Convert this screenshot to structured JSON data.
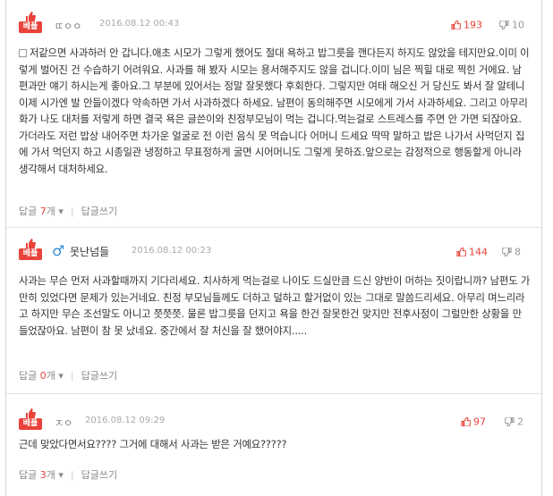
{
  "comments": [
    {
      "badge": "베플",
      "nickname": "ㄸㅇㅇ",
      "date": "2016.08.12 00:43",
      "up": "193",
      "down": "10",
      "text": "저같으면 사과하러 안 갑니다.애초 시모가 그렇게 했어도 절대 욕하고 밥그릇을 깬다든지 하지도 않았을 테지만요.이미 이렇게 벌어진 건 수습하기 어려워요. 사과를 해 봤자 시모는 용서해주지도 않을 겁니다.이미 님은 찍힐 대로 찍힌 거에요. 남편과만 얘기 하시는게 좋아요.그 부분에 있어서는 정말 잘못했다 후회한다. 그렇지만 여태 해오신 거 당신도 봐서 잘 알테니 이제 시가엔 발 안들이겠다 약속하면 가서 사과하겠다 하세요. 남편이 동의해주면 시모에게 가서 사과하세요. 그리고 아무리 화가 나도 대처를 저렇게 하면 결국 욕은 글쓴이와 친정부모님이 먹는 겁니다.먹는걸로 스트레스를 주면 안 가면 되잖아요.가더라도 저런 밥상 내어주면 차가운 얼굴로 전 이런 음식 못 먹습니다 어머니 드세요 딱딱 말하고 밥은 나가서 사먹던지 집에 가서 먹던지 하고 시종일관 냉정하고 무표정하게 굴면 시어머니도 그렇게 못하죠.앞으로는 감정적으로 행동할게 아니라 생각해서 대처하세요.",
      "reply_label": "답글",
      "reply_count": "7",
      "reply_unit": "개",
      "write_label": "답글쓰기"
    },
    {
      "badge": "베플",
      "gender_icon": "♂",
      "nickname": "못난넘들",
      "date": "2016.08.12 00:23",
      "up": "144",
      "down": "8",
      "text": "사과는 무슨 먼저 사과할때까지 기다리세요. 치사하게 먹는걸로 나이도 드실만큼 드신 양반이 머하는 짓이랍니까? 남편도 가만히 있었다면 문제가 있는거네요. 친정 부모님들께도 더하고 덜하고 할거없이 있는 그대로 말씀드리세요. 아무리 며느리라고 하지만 무슨 조선말도 아니고 쯧쯧쯧. 물론 밥그릇을 던지고 욕을 한건 잘못한건 맞지만 전후사정이 그럴만한 상황을 만들었잖아요. 남편이 참 못 났네요. 중간에서 잘 처신을 잘 했어야지.....",
      "reply_label": "답글",
      "reply_count": "0",
      "reply_unit": "개",
      "write_label": "답글쓰기"
    },
    {
      "badge": "베플",
      "nickname": "ㅈㅇ",
      "date": "2016.08.12 09:29",
      "up": "97",
      "down": "2",
      "text": "근데 맞았다면서요???? 그거에 대해서 사과는 받은 거예요?????",
      "reply_label": "답글",
      "reply_count": "3",
      "reply_unit": "개",
      "write_label": "답글쓰기"
    }
  ]
}
